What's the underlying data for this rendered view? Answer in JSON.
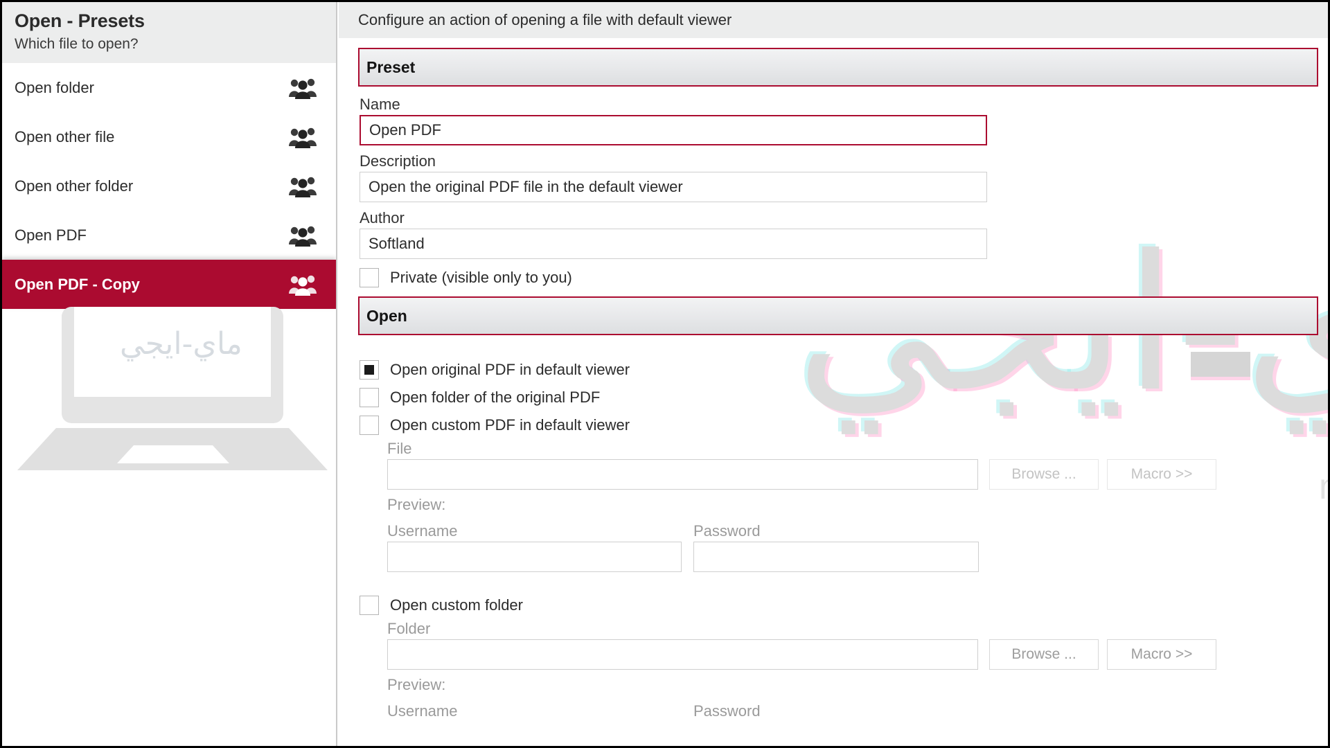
{
  "sidebar": {
    "title": "Open - Presets",
    "subtitle": "Which file to open?",
    "items": [
      {
        "label": "Open folder",
        "icon": "group-icon",
        "selected": false
      },
      {
        "label": "Open other file",
        "icon": "group-icon",
        "selected": false
      },
      {
        "label": "Open other folder",
        "icon": "group-icon",
        "selected": false
      },
      {
        "label": "Open PDF",
        "icon": "group-icon",
        "selected": false
      },
      {
        "label": "Open PDF - Copy",
        "icon": "group-icon",
        "selected": true
      }
    ]
  },
  "main": {
    "header": "Configure an action of opening a file with default viewer",
    "preset_section": {
      "title": "Preset",
      "name_label": "Name",
      "name_value": "Open PDF",
      "description_label": "Description",
      "description_value": "Open the original PDF file in the default viewer",
      "author_label": "Author",
      "author_value": "Softland",
      "private_label": "Private (visible only to you)",
      "private_checked": false
    },
    "open_section": {
      "title": "Open",
      "options": [
        {
          "label": "Open original PDF in default viewer",
          "checked": true
        },
        {
          "label": "Open folder of the original PDF",
          "checked": false
        },
        {
          "label": "Open custom PDF in default viewer",
          "checked": false
        }
      ],
      "custom_pdf": {
        "file_label": "File",
        "file_value": "",
        "browse_label": "Browse ...",
        "macro_label": "Macro >>",
        "preview_label": "Preview:",
        "username_label": "Username",
        "username_value": "",
        "password_label": "Password",
        "password_value": ""
      },
      "custom_folder": {
        "label": "Open custom folder",
        "checked": false,
        "folder_label": "Folder",
        "folder_value": "",
        "browse_label": "Browse ...",
        "macro_label": "Macro >>",
        "preview_label": "Preview:",
        "username_label": "Username",
        "password_label": "Password"
      }
    }
  },
  "watermark": {
    "arabic": "ماي-ايجي",
    "arabic_small": "ماي-ايجي",
    "url": "my-egy.online"
  },
  "colors": {
    "accent": "#ab0b30",
    "selected_bg": "#ab0b30",
    "header_bg": "#eceded",
    "border": "#cfcfcf"
  }
}
